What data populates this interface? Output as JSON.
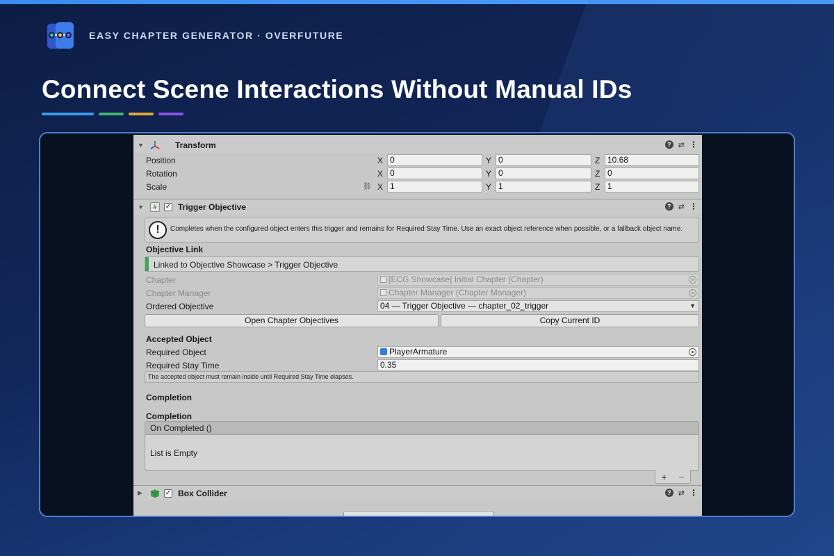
{
  "brand": {
    "name": "EASY CHAPTER GENERATOR · OVERFUTURE",
    "logo_icon": "chapter-flow-logo",
    "logo_colors": [
      "#2f58c8",
      "#3d7be8"
    ],
    "dot_colors": [
      "#3fb9a8",
      "#f0b93a",
      "#7a5cf0"
    ]
  },
  "headline": "Connect Scene Interactions Without Manual IDs",
  "underline_colors": [
    "#3c9af0",
    "#3db86a",
    "#e3a933",
    "#8a55e0"
  ],
  "transform": {
    "title": "Transform",
    "icon": "transform-axes-icon",
    "rows": [
      {
        "label": "Position",
        "x": "0",
        "y": "0",
        "z": "10.68"
      },
      {
        "label": "Rotation",
        "x": "0",
        "y": "0",
        "z": "0"
      },
      {
        "label": "Scale",
        "x": "1",
        "y": "1",
        "z": "1"
      }
    ],
    "axis_labels": {
      "x": "X",
      "y": "Y",
      "z": "Z"
    }
  },
  "trigger": {
    "title": "Trigger Objective",
    "icon": "script-hash-icon",
    "enabled": true,
    "help_text": "Completes when the configured object enters this trigger and remains for Required Stay Time. Use an exact object reference when possible, or a fallback object name.",
    "objective_link_header": "Objective Link",
    "linked_text": "Linked to Objective Showcase > Trigger Objective",
    "link_color": "#3da65a",
    "chapter_label": "Chapter",
    "chapter_value": "[ECG Showcase] Initial Chapter (Chapter)",
    "manager_label": "Chapter Manager",
    "manager_value": "Chapter Manager (Chapter Manager)",
    "ordered_label": "Ordered Objective",
    "ordered_value": "04 — Trigger Objective — chapter_02_trigger",
    "open_button": "Open Chapter Objectives",
    "copy_button": "Copy Current ID",
    "accepted_header": "Accepted Object",
    "required_object_label": "Required Object",
    "required_object_value": "PlayerArmature",
    "stay_time_label": "Required Stay Time",
    "stay_time_value": "0.35",
    "note": "The accepted object must remain inside until Required Stay Time elapses.",
    "completion_header_1": "Completion",
    "completion_header_2": "Completion",
    "event_title": "On Completed ()",
    "event_empty": "List is Empty",
    "plus": "+",
    "minus": "−"
  },
  "box_collider": {
    "title": "Box Collider",
    "icon": "box-collider-cube-icon",
    "enabled": true
  },
  "header_tools": {
    "help": "?",
    "settings": "⇄",
    "menu": "⋮"
  }
}
